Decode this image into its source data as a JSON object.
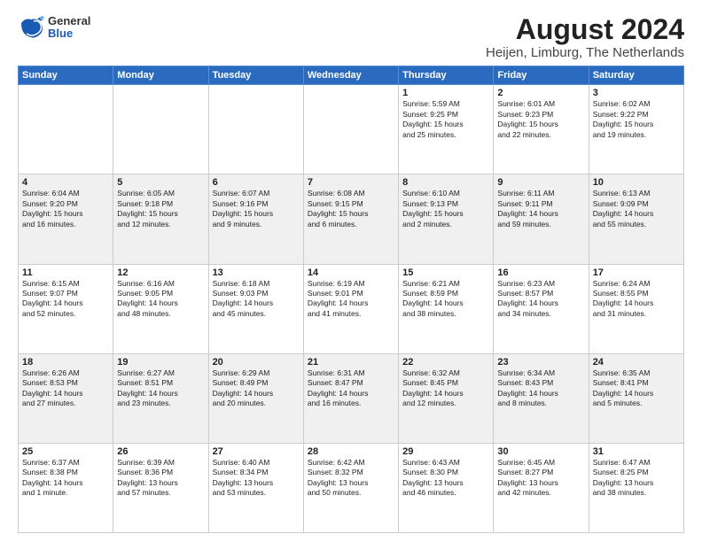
{
  "logo": {
    "general": "General",
    "blue": "Blue"
  },
  "title": "August 2024",
  "subtitle": "Heijen, Limburg, The Netherlands",
  "headers": [
    "Sunday",
    "Monday",
    "Tuesday",
    "Wednesday",
    "Thursday",
    "Friday",
    "Saturday"
  ],
  "weeks": [
    [
      {
        "day": "",
        "info": ""
      },
      {
        "day": "",
        "info": ""
      },
      {
        "day": "",
        "info": ""
      },
      {
        "day": "",
        "info": ""
      },
      {
        "day": "1",
        "info": "Sunrise: 5:59 AM\nSunset: 9:25 PM\nDaylight: 15 hours\nand 25 minutes."
      },
      {
        "day": "2",
        "info": "Sunrise: 6:01 AM\nSunset: 9:23 PM\nDaylight: 15 hours\nand 22 minutes."
      },
      {
        "day": "3",
        "info": "Sunrise: 6:02 AM\nSunset: 9:22 PM\nDaylight: 15 hours\nand 19 minutes."
      }
    ],
    [
      {
        "day": "4",
        "info": "Sunrise: 6:04 AM\nSunset: 9:20 PM\nDaylight: 15 hours\nand 16 minutes."
      },
      {
        "day": "5",
        "info": "Sunrise: 6:05 AM\nSunset: 9:18 PM\nDaylight: 15 hours\nand 12 minutes."
      },
      {
        "day": "6",
        "info": "Sunrise: 6:07 AM\nSunset: 9:16 PM\nDaylight: 15 hours\nand 9 minutes."
      },
      {
        "day": "7",
        "info": "Sunrise: 6:08 AM\nSunset: 9:15 PM\nDaylight: 15 hours\nand 6 minutes."
      },
      {
        "day": "8",
        "info": "Sunrise: 6:10 AM\nSunset: 9:13 PM\nDaylight: 15 hours\nand 2 minutes."
      },
      {
        "day": "9",
        "info": "Sunrise: 6:11 AM\nSunset: 9:11 PM\nDaylight: 14 hours\nand 59 minutes."
      },
      {
        "day": "10",
        "info": "Sunrise: 6:13 AM\nSunset: 9:09 PM\nDaylight: 14 hours\nand 55 minutes."
      }
    ],
    [
      {
        "day": "11",
        "info": "Sunrise: 6:15 AM\nSunset: 9:07 PM\nDaylight: 14 hours\nand 52 minutes."
      },
      {
        "day": "12",
        "info": "Sunrise: 6:16 AM\nSunset: 9:05 PM\nDaylight: 14 hours\nand 48 minutes."
      },
      {
        "day": "13",
        "info": "Sunrise: 6:18 AM\nSunset: 9:03 PM\nDaylight: 14 hours\nand 45 minutes."
      },
      {
        "day": "14",
        "info": "Sunrise: 6:19 AM\nSunset: 9:01 PM\nDaylight: 14 hours\nand 41 minutes."
      },
      {
        "day": "15",
        "info": "Sunrise: 6:21 AM\nSunset: 8:59 PM\nDaylight: 14 hours\nand 38 minutes."
      },
      {
        "day": "16",
        "info": "Sunrise: 6:23 AM\nSunset: 8:57 PM\nDaylight: 14 hours\nand 34 minutes."
      },
      {
        "day": "17",
        "info": "Sunrise: 6:24 AM\nSunset: 8:55 PM\nDaylight: 14 hours\nand 31 minutes."
      }
    ],
    [
      {
        "day": "18",
        "info": "Sunrise: 6:26 AM\nSunset: 8:53 PM\nDaylight: 14 hours\nand 27 minutes."
      },
      {
        "day": "19",
        "info": "Sunrise: 6:27 AM\nSunset: 8:51 PM\nDaylight: 14 hours\nand 23 minutes."
      },
      {
        "day": "20",
        "info": "Sunrise: 6:29 AM\nSunset: 8:49 PM\nDaylight: 14 hours\nand 20 minutes."
      },
      {
        "day": "21",
        "info": "Sunrise: 6:31 AM\nSunset: 8:47 PM\nDaylight: 14 hours\nand 16 minutes."
      },
      {
        "day": "22",
        "info": "Sunrise: 6:32 AM\nSunset: 8:45 PM\nDaylight: 14 hours\nand 12 minutes."
      },
      {
        "day": "23",
        "info": "Sunrise: 6:34 AM\nSunset: 8:43 PM\nDaylight: 14 hours\nand 8 minutes."
      },
      {
        "day": "24",
        "info": "Sunrise: 6:35 AM\nSunset: 8:41 PM\nDaylight: 14 hours\nand 5 minutes."
      }
    ],
    [
      {
        "day": "25",
        "info": "Sunrise: 6:37 AM\nSunset: 8:38 PM\nDaylight: 14 hours\nand 1 minute."
      },
      {
        "day": "26",
        "info": "Sunrise: 6:39 AM\nSunset: 8:36 PM\nDaylight: 13 hours\nand 57 minutes."
      },
      {
        "day": "27",
        "info": "Sunrise: 6:40 AM\nSunset: 8:34 PM\nDaylight: 13 hours\nand 53 minutes."
      },
      {
        "day": "28",
        "info": "Sunrise: 6:42 AM\nSunset: 8:32 PM\nDaylight: 13 hours\nand 50 minutes."
      },
      {
        "day": "29",
        "info": "Sunrise: 6:43 AM\nSunset: 8:30 PM\nDaylight: 13 hours\nand 46 minutes."
      },
      {
        "day": "30",
        "info": "Sunrise: 6:45 AM\nSunset: 8:27 PM\nDaylight: 13 hours\nand 42 minutes."
      },
      {
        "day": "31",
        "info": "Sunrise: 6:47 AM\nSunset: 8:25 PM\nDaylight: 13 hours\nand 38 minutes."
      }
    ]
  ]
}
